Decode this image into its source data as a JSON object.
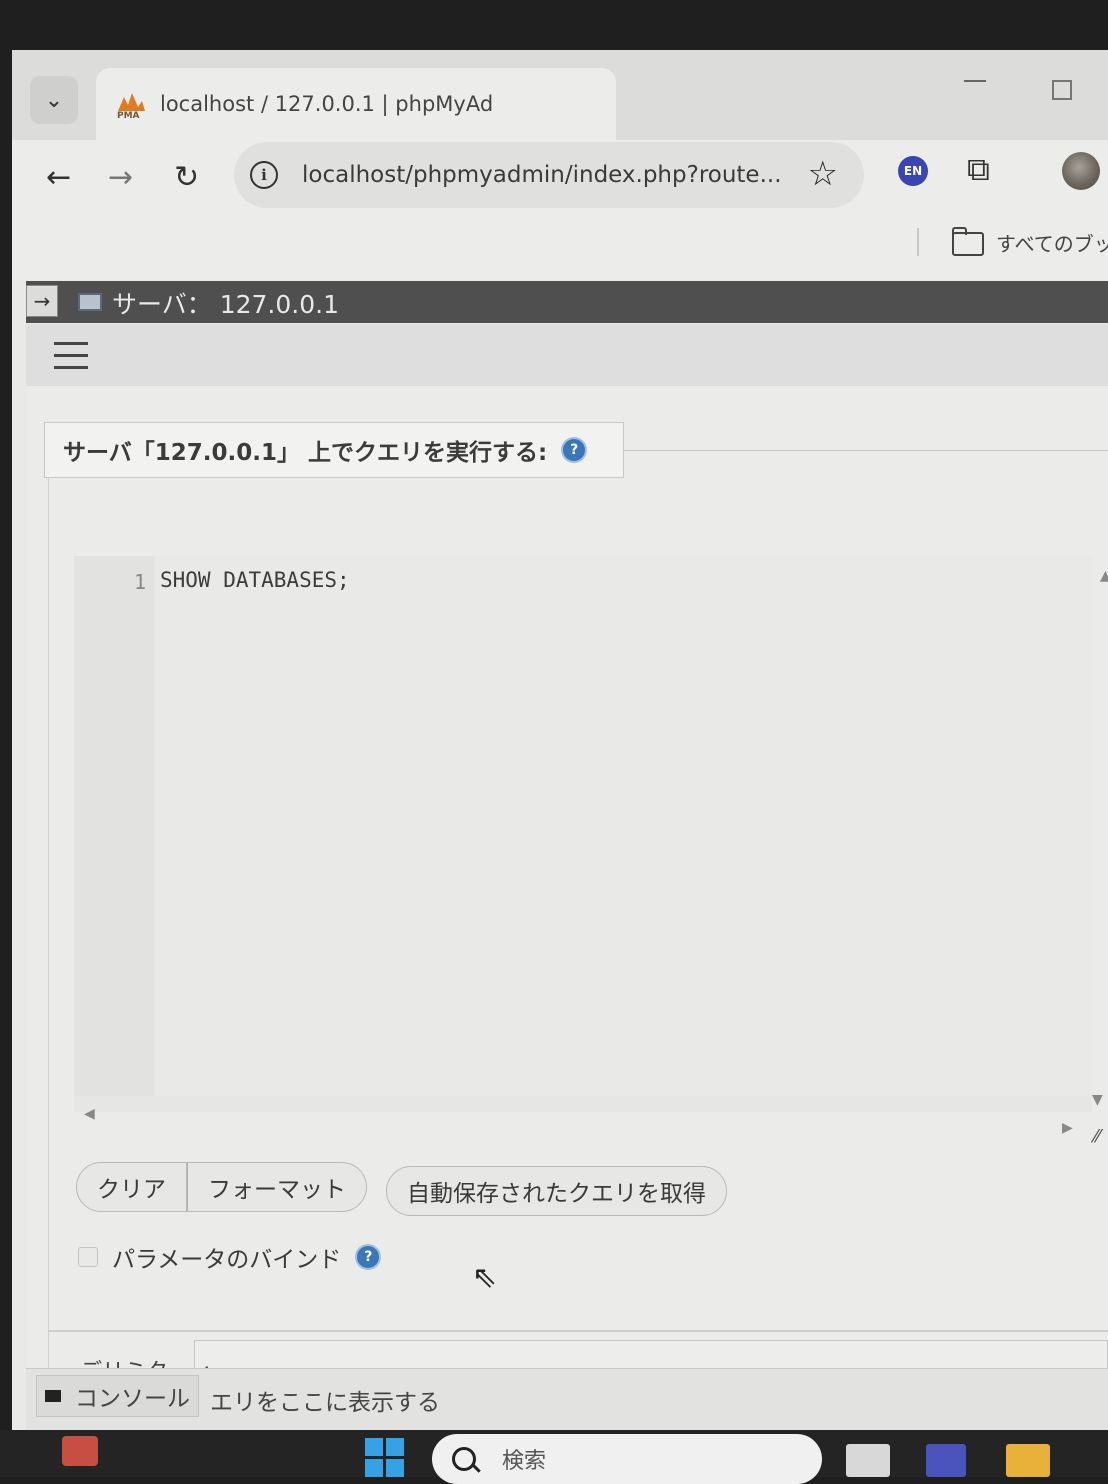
{
  "browser": {
    "tab_title": "localhost / 127.0.0.1 | phpMyAd",
    "url": "localhost/phpmyadmin/index.php?route...",
    "extension_badge": "EN",
    "bookmarks_label": "すべてのブック"
  },
  "pma": {
    "breadcrumb": "サーバ： 127.0.0.1",
    "legend": "サーバ「127.0.0.1」 上でクエリを実行する:",
    "editor": {
      "line_number": "1",
      "query": "SHOW DATABASES;"
    },
    "buttons": {
      "clear": "クリア",
      "format": "フォーマット",
      "get_autosaved": "自動保存されたクエリを取得"
    },
    "bind_parameters_label": "パラメータのバインド",
    "bind_parameters_checked": false,
    "delimiter_label": "デリミタ",
    "delimiter_value": ";"
  },
  "console": {
    "tab_label": "コンソール",
    "message": "エリをここに表示する"
  },
  "taskbar": {
    "search_label": "検索"
  },
  "icons": [
    "chevron-down-icon",
    "pma-logo",
    "back-icon",
    "forward-icon",
    "reload-icon",
    "info-icon",
    "star-icon",
    "puzzle-icon",
    "avatar-icon",
    "folder-icon",
    "collapse-arrow-icon",
    "server-icon",
    "hamburger-icon",
    "help-icon",
    "console-icon",
    "cursor-icon",
    "start-icon",
    "search-icon"
  ]
}
